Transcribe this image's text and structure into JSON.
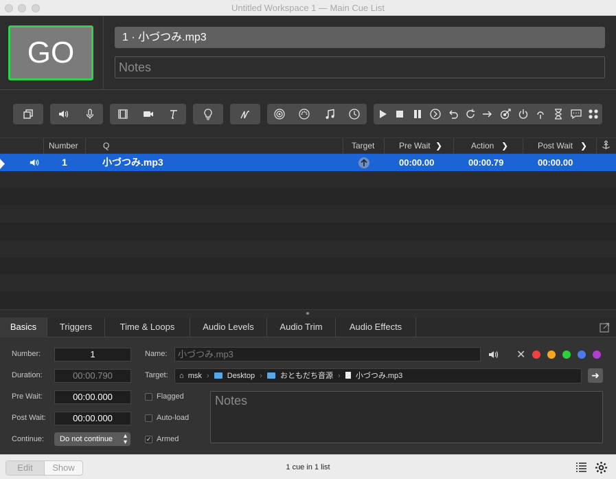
{
  "window": {
    "title": "Untitled Workspace 1 — Main Cue List"
  },
  "go_button": {
    "label": "GO"
  },
  "cue_header": {
    "name": "1 · 小づつみ.mp3",
    "notes_placeholder": "Notes"
  },
  "table": {
    "columns": [
      "Number",
      "Q",
      "Target",
      "Pre Wait",
      "Action",
      "Post Wait"
    ],
    "rows": [
      {
        "number": "1",
        "q": "小づつみ.mp3",
        "pre_wait": "00:00.00",
        "action": "00:00.79",
        "post_wait": "00:00.00"
      }
    ]
  },
  "inspector": {
    "tabs": [
      "Basics",
      "Triggers",
      "Time & Loops",
      "Audio Levels",
      "Audio Trim",
      "Audio Effects"
    ],
    "labels": {
      "number": "Number:",
      "duration": "Duration:",
      "pre_wait": "Pre Wait:",
      "post_wait": "Post Wait:",
      "continue": "Continue:",
      "name": "Name:",
      "target": "Target:"
    },
    "values": {
      "number": "1",
      "duration": "00:00.790",
      "pre_wait": "00:00.000",
      "post_wait": "00:00.000",
      "continue": "Do not continue",
      "name_placeholder": "小づつみ.mp3"
    },
    "target_path": [
      "msk",
      "Desktop",
      "おともだち音源",
      "小づつみ.mp3"
    ],
    "checkboxes": {
      "flagged": "Flagged",
      "autoload": "Auto-load",
      "armed": "Armed"
    },
    "notes_placeholder": "Notes",
    "color_dots": [
      "#f04040",
      "#f5a623",
      "#2dcf3c",
      "#4b7bea",
      "#b23bd0"
    ]
  },
  "footer": {
    "edit": "Edit",
    "show": "Show",
    "status": "1 cue in 1 list"
  }
}
